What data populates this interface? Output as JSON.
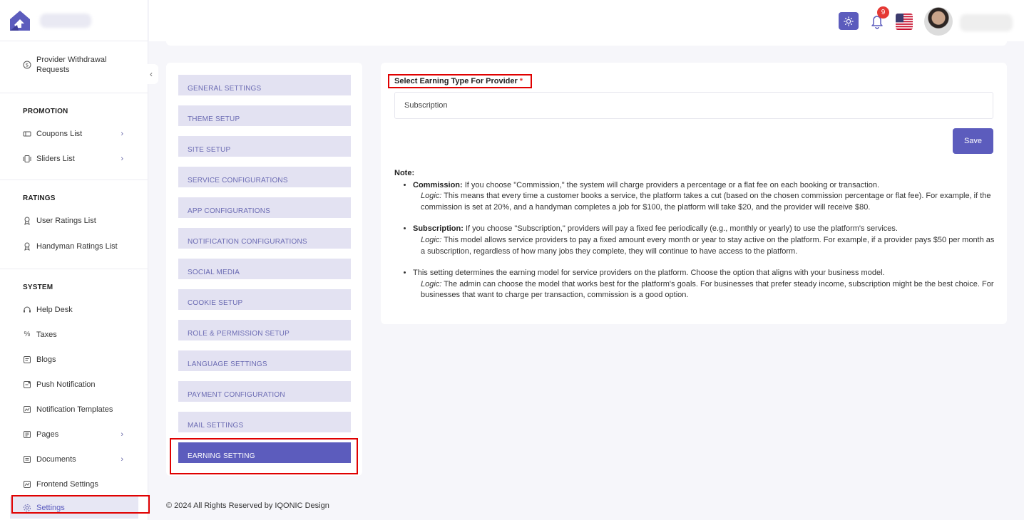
{
  "sidebar": {
    "top_items": [
      {
        "label": "Provider Withdrawal Requests",
        "icon": "dollar-circle-icon"
      }
    ],
    "sections": [
      {
        "title": "PROMOTION",
        "items": [
          {
            "label": "Coupons List",
            "icon": "ticket-icon",
            "has_children": true
          },
          {
            "label": "Sliders List",
            "icon": "slides-icon",
            "has_children": true
          }
        ]
      },
      {
        "title": "RATINGS",
        "items": [
          {
            "label": "User Ratings List",
            "icon": "award-icon"
          },
          {
            "label": "Handyman Ratings List",
            "icon": "award-icon"
          }
        ]
      },
      {
        "title": "SYSTEM",
        "items": [
          {
            "label": "Help Desk",
            "icon": "headset-icon"
          },
          {
            "label": "Taxes",
            "icon": "percent-icon"
          },
          {
            "label": "Blogs",
            "icon": "blog-icon"
          },
          {
            "label": "Push Notification",
            "icon": "push-icon"
          },
          {
            "label": "Notification Templates",
            "icon": "template-icon"
          },
          {
            "label": "Pages",
            "icon": "pages-icon",
            "has_children": true
          },
          {
            "label": "Documents",
            "icon": "document-icon",
            "has_children": true
          },
          {
            "label": "Frontend Settings",
            "icon": "frontend-icon"
          },
          {
            "label": "Settings",
            "icon": "gear-icon",
            "active": true
          }
        ]
      }
    ]
  },
  "topbar": {
    "notification_count": "9"
  },
  "settings_menu": {
    "items": [
      "GENERAL SETTINGS",
      "THEME SETUP",
      "SITE SETUP",
      "SERVICE CONFIGURATIONS",
      "APP CONFIGURATIONS",
      "NOTIFICATION CONFIGURATIONS",
      "SOCIAL MEDIA",
      "COOKIE SETUP",
      "ROLE & PERMISSION SETUP",
      "LANGUAGE SETTINGS",
      "PAYMENT CONFIGURATION",
      "MAIL SETTINGS",
      "EARNING SETTING"
    ],
    "active": "EARNING SETTING"
  },
  "form": {
    "label": "Select Earning Type For Provider",
    "required_mark": "*",
    "selected_value": "Subscription",
    "save_label": "Save"
  },
  "notes": {
    "title": "Note:",
    "items": [
      {
        "heading": "Commission:",
        "text": " If you choose \"Commission,\" the system will charge providers a percentage or a flat fee on each booking or transaction.",
        "logic_label": "Logic:",
        "logic_text": " This means that every time a customer books a service, the platform takes a cut (based on the chosen commission percentage or flat fee). For example, if the commission is set at 20%, and a handyman completes a job for $100, the platform will take $20, and the provider will receive $80."
      },
      {
        "heading": "Subscription:",
        "text": " If you choose \"Subscription,\" providers will pay a fixed fee periodically (e.g., monthly or yearly) to use the platform's services.",
        "logic_label": "Logic:",
        "logic_text": " This model allows service providers to pay a fixed amount every month or year to stay active on the platform. For example, if a provider pays $50 per month as a subscription, regardless of how many jobs they complete, they will continue to have access to the platform."
      },
      {
        "heading": "",
        "text": "This setting determines the earning model for service providers on the platform. Choose the option that aligns with your business model.",
        "logic_label": "Logic:",
        "logic_text": " The admin can choose the model that works best for the platform's goals. For businesses that prefer steady income, subscription might be the best choice. For businesses that want to charge per transaction, commission is a good option."
      }
    ]
  },
  "footer": {
    "text": "© 2024 All Rights Reserved by IQONIC Design"
  },
  "colors": {
    "accent": "#5c5cbd",
    "menu_bg": "#e3e2f2",
    "highlight": "#e00000",
    "badge": "#e53935"
  }
}
